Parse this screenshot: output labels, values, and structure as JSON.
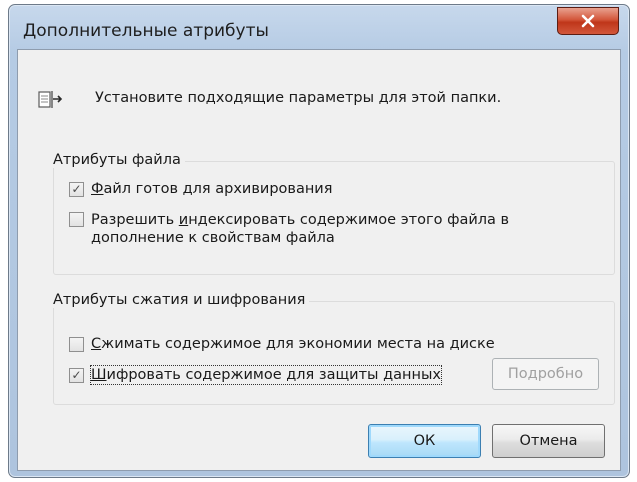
{
  "window": {
    "title": "Дополнительные атрибуты",
    "close_symbol": "x"
  },
  "header": {
    "icon": "folder-properties-icon",
    "text": "Установите подходящие параметры для этой папки."
  },
  "file_attributes": {
    "title": "Атрибуты файла",
    "archive": {
      "label_prefix": "",
      "label_access": "Ф",
      "label_rest": "айл готов для архивирования",
      "checked": true,
      "enabled": false
    },
    "index": {
      "label_line1_prefix": "Разрешить ",
      "label_line1_access": "и",
      "label_line1_rest": "ндексировать содержимое этого файла в",
      "label_line2": "дополнение к свойствам файла",
      "checked": false,
      "enabled": false
    }
  },
  "compression_attributes": {
    "title": "Атрибуты сжатия и шифрования",
    "compress": {
      "label_access": "С",
      "label_rest": "жимать содержимое для экономии места на диске",
      "checked": false,
      "enabled": false
    },
    "encrypt": {
      "label_access": "Ш",
      "label_rest": "ифровать содержимое для защиты данных",
      "checked": true,
      "enabled": false
    },
    "details_button": {
      "label_prefix": "Подро",
      "label_access": "б",
      "label_rest": "но",
      "enabled": false
    }
  },
  "buttons": {
    "ok": "ОК",
    "cancel": "Отмена"
  },
  "colors": {
    "close_button": "#c8462a",
    "ok_border": "#3c7fb1",
    "disabled_text": "#a0a0a0"
  }
}
